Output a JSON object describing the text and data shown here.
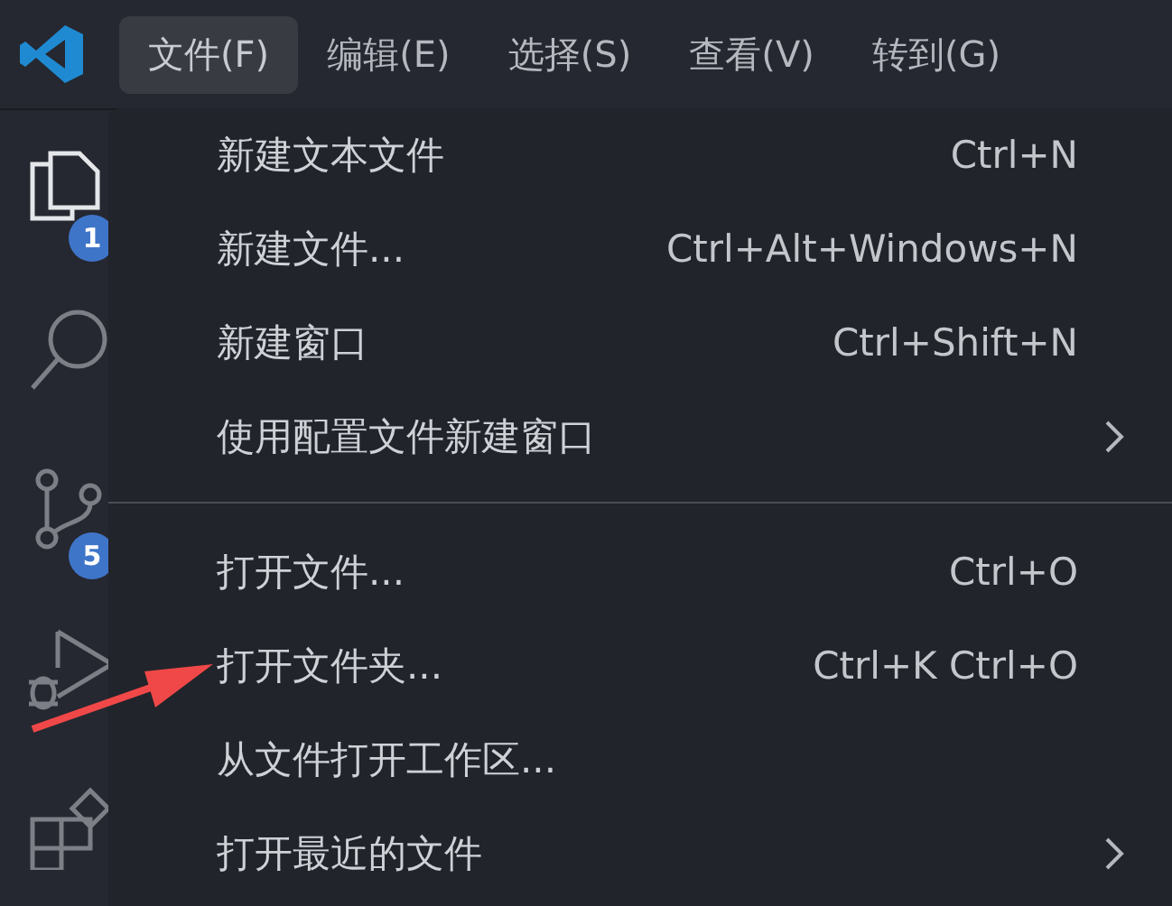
{
  "menubar": [
    {
      "label": "文件(F)",
      "selected": true
    },
    {
      "label": "编辑(E)",
      "selected": false
    },
    {
      "label": "选择(S)",
      "selected": false
    },
    {
      "label": "查看(V)",
      "selected": false
    },
    {
      "label": "转到(G)",
      "selected": false
    }
  ],
  "activity_bar": [
    {
      "kind": "explorer",
      "selected": true,
      "badge": "1"
    },
    {
      "kind": "search",
      "selected": false
    },
    {
      "kind": "source-control",
      "selected": false,
      "badge": "5"
    },
    {
      "kind": "run",
      "selected": false
    },
    {
      "kind": "extensions",
      "selected": false
    }
  ],
  "file_menu": {
    "sections": [
      {
        "items": [
          {
            "label": "新建文本文件",
            "shortcut": "Ctrl+N",
            "submenu": false
          },
          {
            "label": "新建文件...",
            "shortcut": "Ctrl+Alt+Windows+N",
            "submenu": false
          },
          {
            "label": "新建窗口",
            "shortcut": "Ctrl+Shift+N",
            "submenu": false
          },
          {
            "label": "使用配置文件新建窗口",
            "submenu": true
          }
        ]
      },
      {
        "items": [
          {
            "label": "打开文件...",
            "shortcut": "Ctrl+O",
            "submenu": false
          },
          {
            "label": "打开文件夹...",
            "shortcut": "Ctrl+K Ctrl+O",
            "submenu": false
          },
          {
            "label": "从文件打开工作区...",
            "submenu": false
          },
          {
            "label": "打开最近的文件",
            "submenu": true
          }
        ]
      }
    ]
  }
}
